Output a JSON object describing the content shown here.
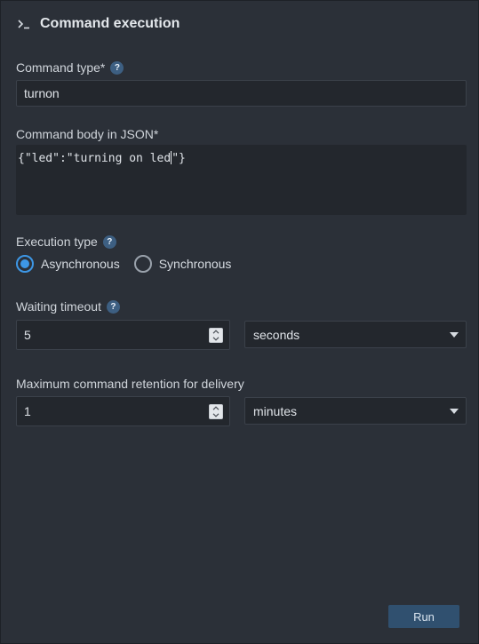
{
  "header": {
    "icon": "terminal-prompt-icon",
    "title": "Command execution"
  },
  "command_type": {
    "label": "Command type*",
    "help": "?",
    "value": "turnon"
  },
  "command_body": {
    "label": "Command body in JSON*",
    "value_before_caret": "{\"led\":\"turning on led",
    "value_after_caret": "\"}"
  },
  "execution_type": {
    "label": "Execution type",
    "help": "?",
    "options": [
      {
        "label": "Asynchronous",
        "selected": true
      },
      {
        "label": "Synchronous",
        "selected": false
      }
    ]
  },
  "waiting_timeout": {
    "label": "Waiting timeout",
    "help": "?",
    "value": "5",
    "unit": "seconds"
  },
  "retention": {
    "label": "Maximum command retention for delivery",
    "value": "1",
    "unit": "minutes"
  },
  "actions": {
    "run_label": "Run"
  },
  "colors": {
    "background": "#2b3038",
    "input_background": "#23272d",
    "accent": "#3d97e6",
    "button": "#30506f"
  }
}
